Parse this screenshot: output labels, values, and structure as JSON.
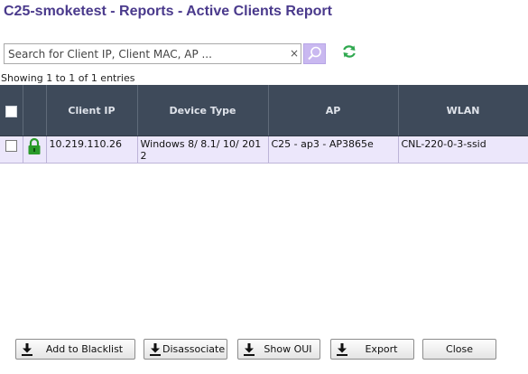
{
  "page": {
    "title": "C25-smoketest - Reports - Active Clients Report"
  },
  "search": {
    "placeholder": "Search for Client IP, Client MAC, AP ...",
    "clear_icon": "×"
  },
  "showing_text": "Showing 1 to 1 of 1 entries",
  "table": {
    "columns": [
      "",
      "",
      "Client IP",
      "Device Type",
      "AP",
      "WLAN"
    ],
    "rows": [
      {
        "status_icon": "lock-icon",
        "client_ip": "10.219.110.26",
        "device_type": "Windows 8/ 8.1/ 10/ 2012",
        "ap": "C25 - ap3 - AP3865e",
        "wlan": "CNL-220-0-3-ssid"
      }
    ]
  },
  "buttons": {
    "blacklist": "Add to Blacklist",
    "disassociate": "Disassociate",
    "show_oui": "Show OUI",
    "export": "Export",
    "close": "Close"
  },
  "colors": {
    "title": "#4a3a8c",
    "header_bg": "#3e4a5a",
    "row_bg": "#ece7fb",
    "lock_green": "#2a9a2a",
    "refresh_green": "#2fa84f",
    "search_button": "#c9b8f0"
  }
}
